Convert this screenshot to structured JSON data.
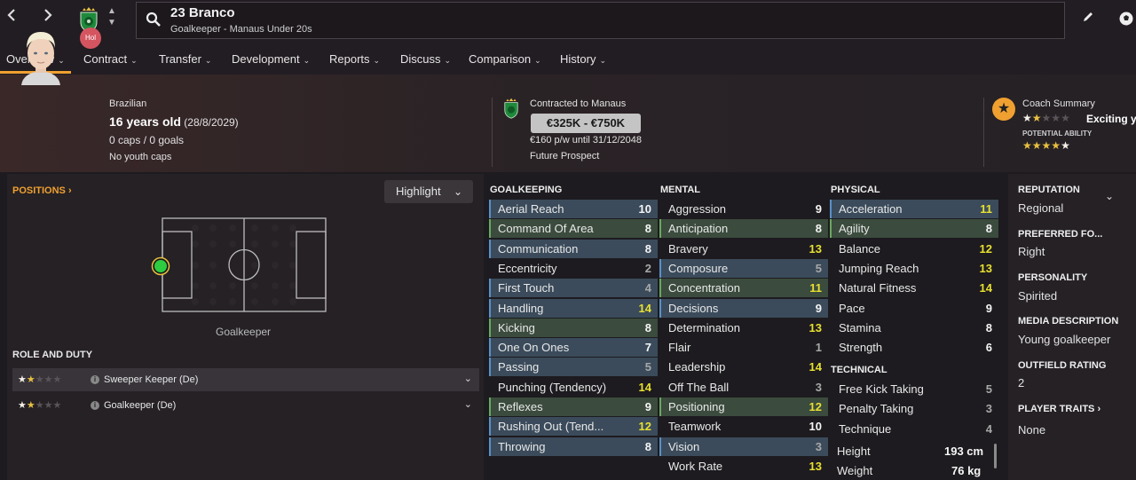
{
  "topbar": {
    "player_title": "23 Branco",
    "player_subtitle": "Goalkeeper - Manaus Under 20s",
    "icons": [
      "back-arrow-icon",
      "forward-arrow-icon",
      "club-crest-icon",
      "search-icon",
      "pencil-icon",
      "football-icon"
    ]
  },
  "menu": {
    "items": [
      "Overview",
      "Contract",
      "Transfer",
      "Development",
      "Reports",
      "Discuss",
      "Comparison",
      "History"
    ],
    "active": "Overview",
    "accent": "#f0a030"
  },
  "header": {
    "nationality_badge": "Hol",
    "nationality": "Brazilian",
    "age": "16 years old",
    "dob": "(28/8/2029)",
    "caps": "0 caps / 0 goals",
    "youth_caps": "No youth caps",
    "contract_label": "Contracted to Manaus",
    "value_range": "€325K - €750K",
    "wage": "€160 p/w until 31/12/2048",
    "prospect": "Future Prospect",
    "coach_summary_label": "Coach Summary",
    "coach_summary_text": "Exciting y",
    "potential_label": "POTENTIAL ABILITY",
    "current_stars": 1.5,
    "potential_stars": 4.5
  },
  "positions": {
    "title": "POSITIONS",
    "highlight_label": "Highlight",
    "position_label": "Goalkeeper",
    "role_title": "ROLE AND DUTY",
    "roles": [
      {
        "name": "Sweeper Keeper (De)",
        "stars": 1.5,
        "selected": true
      },
      {
        "name": "Goalkeeper (De)",
        "stars": 1.5,
        "selected": false
      }
    ]
  },
  "goalkeeping": {
    "title": "GOALKEEPING",
    "attrs": [
      {
        "name": "Aerial Reach",
        "value": "10",
        "hl": "blue",
        "col": "white"
      },
      {
        "name": "Command Of Area",
        "value": "8",
        "hl": "green",
        "col": "white"
      },
      {
        "name": "Communication",
        "value": "8",
        "hl": "blue",
        "col": "white"
      },
      {
        "name": "Eccentricity",
        "value": "2",
        "hl": "plain",
        "col": "grey"
      },
      {
        "name": "First Touch",
        "value": "4",
        "hl": "blue",
        "col": "grey"
      },
      {
        "name": "Handling",
        "value": "14",
        "hl": "blue",
        "col": "yellow"
      },
      {
        "name": "Kicking",
        "value": "8",
        "hl": "green",
        "col": "white"
      },
      {
        "name": "One On Ones",
        "value": "7",
        "hl": "blue",
        "col": "white"
      },
      {
        "name": "Passing",
        "value": "5",
        "hl": "blue",
        "col": "grey"
      },
      {
        "name": "Punching (Tendency)",
        "value": "14",
        "hl": "plain",
        "col": "yellow"
      },
      {
        "name": "Reflexes",
        "value": "9",
        "hl": "green",
        "col": "white"
      },
      {
        "name": "Rushing Out (Tend...",
        "value": "12",
        "hl": "blue",
        "col": "yellow"
      },
      {
        "name": "Throwing",
        "value": "8",
        "hl": "blue",
        "col": "white"
      }
    ]
  },
  "mental": {
    "title": "MENTAL",
    "attrs": [
      {
        "name": "Aggression",
        "value": "9",
        "hl": "plain",
        "col": "white"
      },
      {
        "name": "Anticipation",
        "value": "8",
        "hl": "green",
        "col": "white"
      },
      {
        "name": "Bravery",
        "value": "13",
        "hl": "plain",
        "col": "yellow"
      },
      {
        "name": "Composure",
        "value": "5",
        "hl": "blue",
        "col": "grey"
      },
      {
        "name": "Concentration",
        "value": "11",
        "hl": "green",
        "col": "yellow"
      },
      {
        "name": "Decisions",
        "value": "9",
        "hl": "blue",
        "col": "white"
      },
      {
        "name": "Determination",
        "value": "13",
        "hl": "plain",
        "col": "yellow"
      },
      {
        "name": "Flair",
        "value": "1",
        "hl": "plain",
        "col": "grey"
      },
      {
        "name": "Leadership",
        "value": "14",
        "hl": "plain",
        "col": "yellow"
      },
      {
        "name": "Off The Ball",
        "value": "3",
        "hl": "plain",
        "col": "grey"
      },
      {
        "name": "Positioning",
        "value": "12",
        "hl": "green",
        "col": "yellow"
      },
      {
        "name": "Teamwork",
        "value": "10",
        "hl": "plain",
        "col": "white"
      },
      {
        "name": "Vision",
        "value": "3",
        "hl": "blue",
        "col": "grey"
      },
      {
        "name": "Work Rate",
        "value": "13",
        "hl": "plain",
        "col": "yellow"
      }
    ]
  },
  "physical": {
    "title": "PHYSICAL",
    "attrs": [
      {
        "name": "Acceleration",
        "value": "11",
        "hl": "blue",
        "col": "yellow"
      },
      {
        "name": "Agility",
        "value": "8",
        "hl": "green",
        "col": "white"
      },
      {
        "name": "Balance",
        "value": "12",
        "hl": "plain",
        "col": "yellow"
      },
      {
        "name": "Jumping Reach",
        "value": "13",
        "hl": "plain",
        "col": "yellow"
      },
      {
        "name": "Natural Fitness",
        "value": "14",
        "hl": "plain",
        "col": "yellow"
      },
      {
        "name": "Pace",
        "value": "9",
        "hl": "plain",
        "col": "white"
      },
      {
        "name": "Stamina",
        "value": "8",
        "hl": "plain",
        "col": "white"
      },
      {
        "name": "Strength",
        "value": "6",
        "hl": "plain",
        "col": "white"
      }
    ]
  },
  "technical": {
    "title": "TECHNICAL",
    "attrs": [
      {
        "name": "Free Kick Taking",
        "value": "5",
        "hl": "plain",
        "col": "grey"
      },
      {
        "name": "Penalty Taking",
        "value": "3",
        "hl": "plain",
        "col": "grey"
      },
      {
        "name": "Technique",
        "value": "4",
        "hl": "plain",
        "col": "grey"
      }
    ],
    "height_label": "Height",
    "height": "193 cm",
    "weight_label": "Weight",
    "weight": "76 kg"
  },
  "info": {
    "reputation_label": "REPUTATION",
    "reputation": "Regional",
    "foot_label": "PREFERRED FO...",
    "foot": "Right",
    "personality_label": "PERSONALITY",
    "personality": "Spirited",
    "media_label": "MEDIA DESCRIPTION",
    "media": "Young goalkeeper",
    "outfield_label": "OUTFIELD RATING",
    "outfield": "2",
    "traits_label": "PLAYER TRAITS",
    "traits": "None"
  }
}
